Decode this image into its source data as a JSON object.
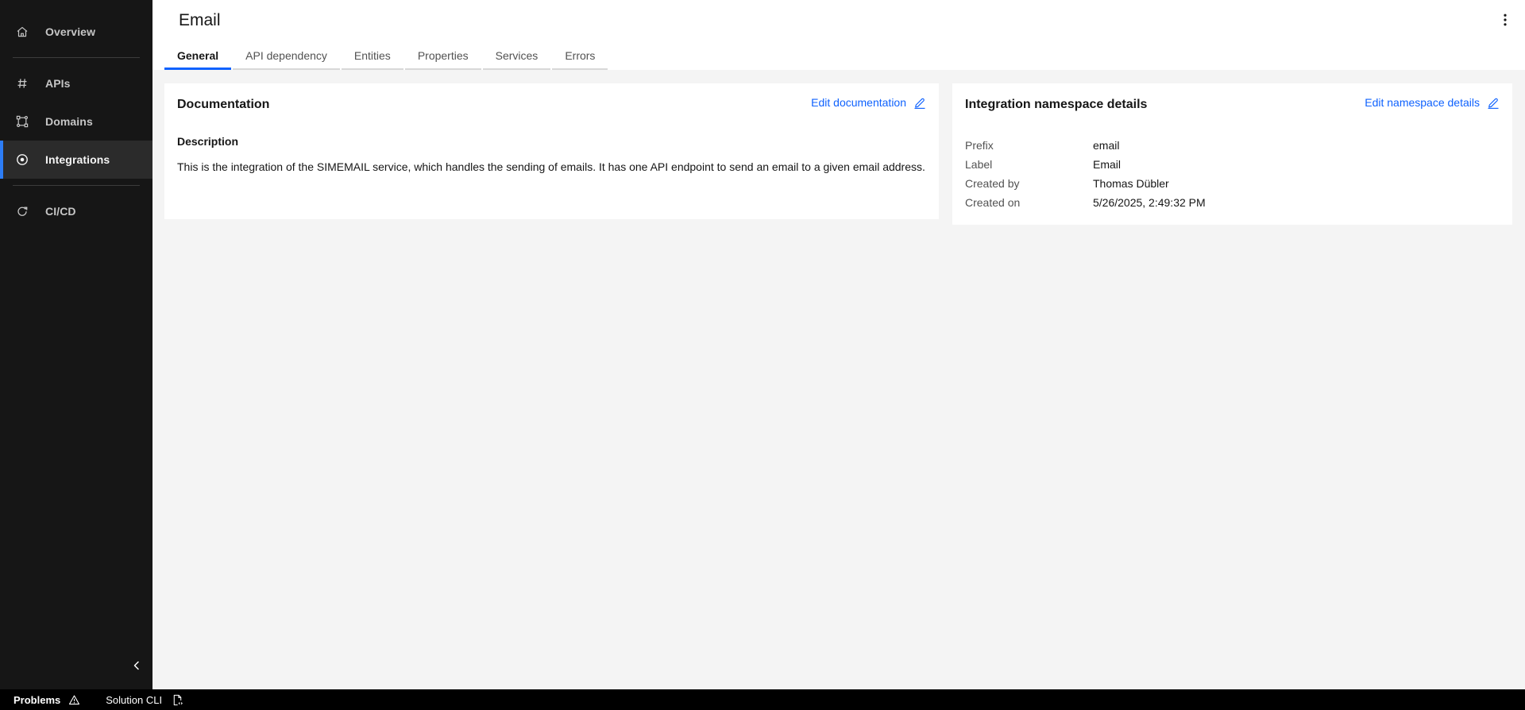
{
  "colors": {
    "accent_blue": "#0f62fe",
    "sidebar_active_border": "#2d7df6",
    "sidebar_bg": "#161616",
    "sidebar_active_bg": "#2b2b2b",
    "page_bg": "#f4f4f4",
    "card_bg": "#ffffff",
    "status_bar_bg": "#000000",
    "text_primary": "#161616",
    "text_secondary": "#525252",
    "sidebar_text": "#c6c6c6"
  },
  "sidebar": {
    "items": [
      {
        "label": "Overview",
        "icon": "home-icon",
        "active": false
      },
      {
        "label": "APIs",
        "icon": "hash-icon",
        "active": false
      },
      {
        "label": "Domains",
        "icon": "domains-icon",
        "active": false
      },
      {
        "label": "Integrations",
        "icon": "integrations-icon",
        "active": true
      },
      {
        "label": "CI/CD",
        "icon": "cicd-icon",
        "active": false
      }
    ],
    "collapse_icon": "chevron-left-icon"
  },
  "header": {
    "title": "Email",
    "overflow_menu_icon": "kebab-icon",
    "tabs": [
      {
        "label": "General",
        "active": true
      },
      {
        "label": "API dependency",
        "active": false
      },
      {
        "label": "Entities",
        "active": false
      },
      {
        "label": "Properties",
        "active": false
      },
      {
        "label": "Services",
        "active": false
      },
      {
        "label": "Errors",
        "active": false
      }
    ]
  },
  "documentation_card": {
    "title": "Documentation",
    "edit_link": "Edit documentation",
    "edit_icon": "pencil-icon",
    "section_title": "Description",
    "body": "This is the integration of the SIMEMAIL service, which handles the sending of emails. It has one API endpoint to send an email to a given email address."
  },
  "namespace_card": {
    "title": "Integration namespace details",
    "edit_link": "Edit namespace details",
    "edit_icon": "pencil-icon",
    "fields": [
      {
        "label": "Prefix",
        "value": "email"
      },
      {
        "label": "Label",
        "value": "Email"
      },
      {
        "label": "Created by",
        "value": "Thomas Dübler"
      },
      {
        "label": "Created on",
        "value": "5/26/2025, 2:49:32 PM"
      }
    ]
  },
  "status_bar": {
    "problems_label": "Problems",
    "problems_icon": "warning-icon",
    "solution_cli_label": "Solution CLI",
    "solution_cli_icon": "script-file-icon"
  }
}
